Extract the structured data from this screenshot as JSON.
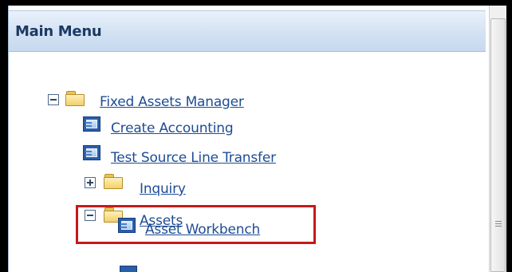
{
  "panel": {
    "title": "Main Menu"
  },
  "menu": {
    "fixed_assets_manager": "Fixed Assets Manager",
    "create_accounting": "Create Accounting",
    "test_source_line_transfer": "Test Source Line Transfer",
    "inquiry": "Inquiry",
    "assets": "Assets",
    "asset_workbench": "Asset Workbench"
  },
  "colors": {
    "header_background": "#d3e2f3",
    "title_text": "#1c3a63",
    "link": "#1e4c95",
    "highlight": "#c51a1a",
    "folder": "#f2d06c",
    "function_icon": "#2b5ea8"
  },
  "icons": {
    "expanded_toggle": "minus-box-icon",
    "collapsed_toggle": "plus-box-icon",
    "folder": "folder-icon",
    "function": "function-window-icon"
  }
}
